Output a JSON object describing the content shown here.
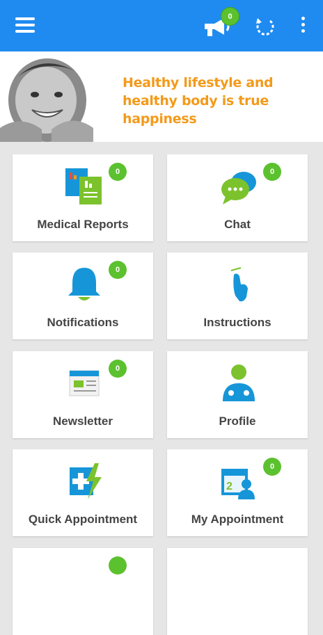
{
  "header": {
    "notification_count": "0",
    "icons": [
      "menu-icon",
      "megaphone-icon",
      "refresh-icon",
      "more-vert-icon"
    ],
    "color": "#1f8bf0"
  },
  "banner": {
    "tagline": "Healthy lifestyle and healthy body is true happiness"
  },
  "tiles": [
    {
      "label": "Medical Reports",
      "badge": "0",
      "icon": "reports-icon"
    },
    {
      "label": "Chat",
      "badge": "0",
      "icon": "chat-icon"
    },
    {
      "label": "Notifications",
      "badge": "0",
      "icon": "bell-icon"
    },
    {
      "label": "Instructions",
      "icon": "tap-hand-icon"
    },
    {
      "label": "Newsletter",
      "badge": "0",
      "icon": "newsletter-icon"
    },
    {
      "label": "Profile",
      "icon": "doctor-icon"
    },
    {
      "label": "Quick Appointment",
      "icon": "medical-flash-icon"
    },
    {
      "label": "My Appointment",
      "badge": "0",
      "icon": "calendar-user-icon"
    }
  ],
  "colors": {
    "badge": "#5cc12f",
    "tagline": "#f39a1a",
    "icon_blue": "#1696d8",
    "icon_green": "#7cc22d"
  }
}
